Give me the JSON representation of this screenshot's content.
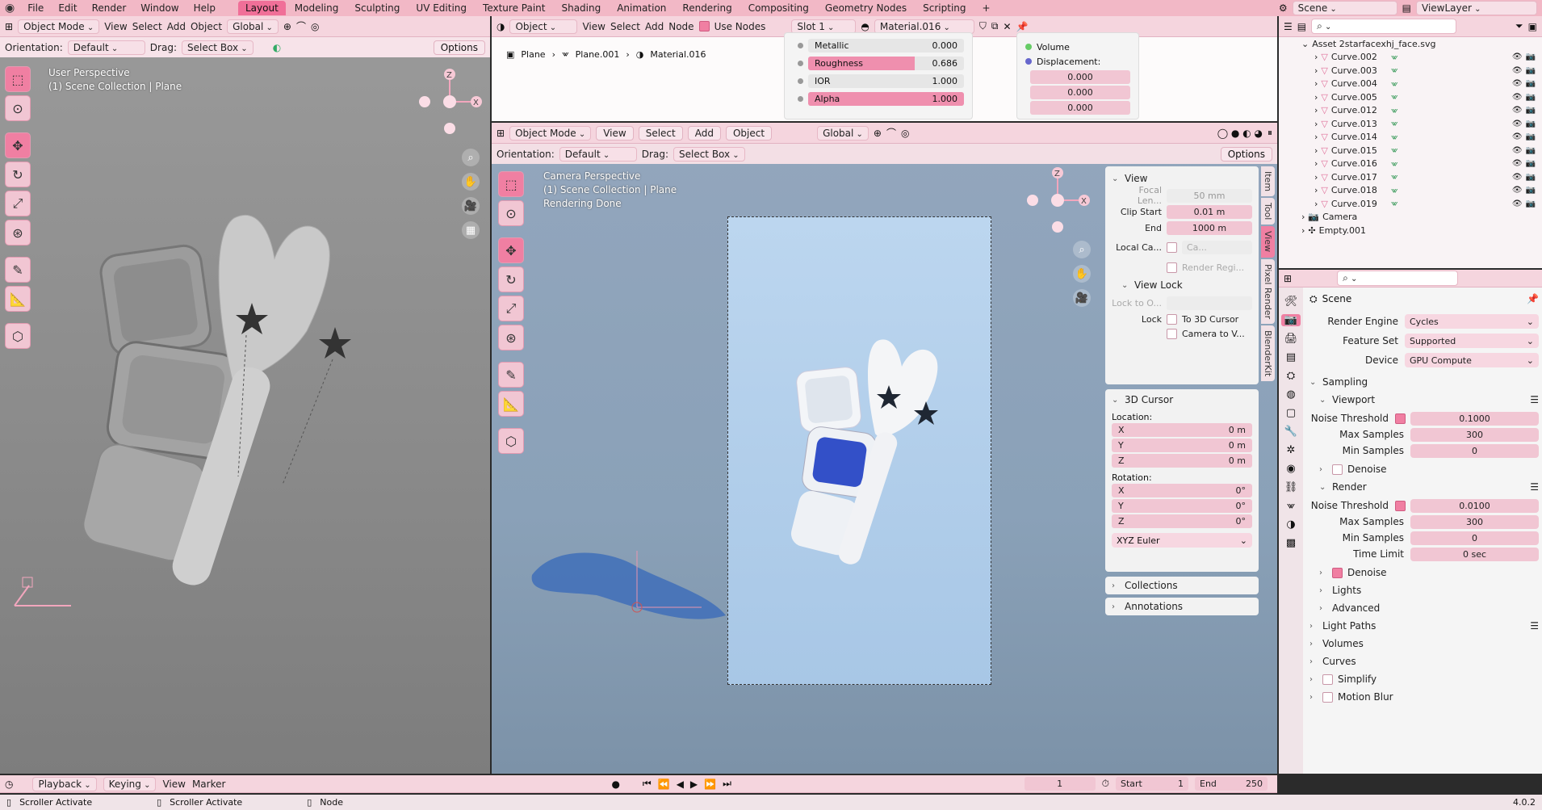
{
  "topbar": {
    "menus": [
      "File",
      "Edit",
      "Render",
      "Window",
      "Help"
    ],
    "workspaces": [
      "Layout",
      "Modeling",
      "Sculpting",
      "UV Editing",
      "Texture Paint",
      "Shading",
      "Animation",
      "Rendering",
      "Compositing",
      "Geometry Nodes",
      "Scripting"
    ],
    "active_workspace": "Layout",
    "add_tab": "+",
    "scene": "Scene",
    "view_layer": "ViewLayer"
  },
  "left_viewport": {
    "mode": "Object Mode",
    "menus": [
      "View",
      "Select",
      "Add",
      "Object"
    ],
    "transform": "Global",
    "orientation_label": "Orientation:",
    "orientation": "Default",
    "drag_label": "Drag:",
    "drag": "Select Box",
    "options": "Options",
    "overlay_line1": "User Perspective",
    "overlay_line2": "(1) Scene Collection | Plane"
  },
  "shader_editor": {
    "type": "Object",
    "menus": [
      "View",
      "Select",
      "Add",
      "Node"
    ],
    "use_nodes": "Use Nodes",
    "slot": "Slot 1",
    "material": "Material.016",
    "breadcrumb": [
      "Plane",
      "Plane.001",
      "Material.016"
    ],
    "node_fields": [
      {
        "label": "Metallic",
        "value": "0.000",
        "fill": 0.0
      },
      {
        "label": "Roughness",
        "value": "0.686",
        "fill": 0.686
      },
      {
        "label": "IOR",
        "value": "1.000",
        "fill": 0.0
      },
      {
        "label": "Alpha",
        "value": "1.000",
        "fill": 1.0
      }
    ],
    "output_labels": [
      "Volume",
      "Displacement:"
    ],
    "displacement_values": [
      "0.000",
      "0.000",
      "0.000"
    ]
  },
  "camera_viewport": {
    "mode": "Object Mode",
    "menus": [
      "View",
      "Select",
      "Add",
      "Object"
    ],
    "transform": "Global",
    "orientation_label": "Orientation:",
    "orientation": "Default",
    "drag_label": "Drag:",
    "drag": "Select Box",
    "options": "Options",
    "overlay_line1": "Camera Perspective",
    "overlay_line2": "(1) Scene Collection | Plane",
    "overlay_line3": "Rendering Done",
    "side_tabs": [
      "Item",
      "Tool",
      "View",
      "Pixel Render",
      "BlenderKit"
    ]
  },
  "n_panel": {
    "view_title": "View",
    "focal_label": "Focal Len...",
    "focal_value": "50 mm",
    "clip_start_label": "Clip Start",
    "clip_start_value": "0.01 m",
    "clip_end_label": "End",
    "clip_end_value": "1000 m",
    "local_cam_label": "Local Ca...",
    "local_cam_value": "Ca...",
    "render_region": "Render Regi...",
    "view_lock_title": "View Lock",
    "lock_to_label": "Lock to O...",
    "lock_label": "Lock",
    "lock_3d_cursor": "To 3D Cursor",
    "lock_camera": "Camera to V...",
    "cursor_title": "3D Cursor",
    "location_label": "Location:",
    "location": [
      {
        "axis": "X",
        "value": "0 m"
      },
      {
        "axis": "Y",
        "value": "0 m"
      },
      {
        "axis": "Z",
        "value": "0 m"
      }
    ],
    "rotation_label": "Rotation:",
    "rotation": [
      {
        "axis": "X",
        "value": "0°"
      },
      {
        "axis": "Y",
        "value": "0°"
      },
      {
        "axis": "Z",
        "value": "0°"
      }
    ],
    "rotation_mode": "XYZ Euler",
    "collections": "Collections",
    "annotations": "Annotations"
  },
  "outliner": {
    "top_item": "Asset 2starfacexhj_face.svg",
    "curves": [
      "Curve.002",
      "Curve.003",
      "Curve.004",
      "Curve.005",
      "Curve.012",
      "Curve.013",
      "Curve.014",
      "Curve.015",
      "Curve.016",
      "Curve.017",
      "Curve.018",
      "Curve.019"
    ],
    "camera": "Camera",
    "empty": "Empty.001"
  },
  "properties": {
    "scene_label": "Scene",
    "render_engine_label": "Render Engine",
    "render_engine": "Cycles",
    "feature_set_label": "Feature Set",
    "feature_set": "Supported",
    "device_label": "Device",
    "device": "GPU Compute",
    "sampling": "Sampling",
    "viewport": "Viewport",
    "vp_noise_label": "Noise Threshold",
    "vp_noise": "0.1000",
    "vp_max_label": "Max Samples",
    "vp_max": "300",
    "vp_min_label": "Min Samples",
    "vp_min": "0",
    "denoise": "Denoise",
    "render": "Render",
    "r_noise_label": "Noise Threshold",
    "r_noise": "0.0100",
    "r_max_label": "Max Samples",
    "r_max": "300",
    "r_min_label": "Min Samples",
    "r_min": "0",
    "time_limit_label": "Time Limit",
    "time_limit": "0 sec",
    "r_denoise": "Denoise",
    "lights": "Lights",
    "advanced": "Advanced",
    "light_paths": "Light Paths",
    "volumes": "Volumes",
    "curves": "Curves",
    "simplify": "Simplify",
    "motion_blur": "Motion Blur"
  },
  "timeline": {
    "playback": "Playback",
    "keying": "Keying",
    "view": "View",
    "marker": "Marker",
    "current_frame": "1",
    "start_label": "Start",
    "start": "1",
    "end_label": "End",
    "end": "250"
  },
  "statusbar": {
    "item1": "Scroller Activate",
    "item2": "Scroller Activate",
    "item3": "Node",
    "version": "4.0.2"
  }
}
